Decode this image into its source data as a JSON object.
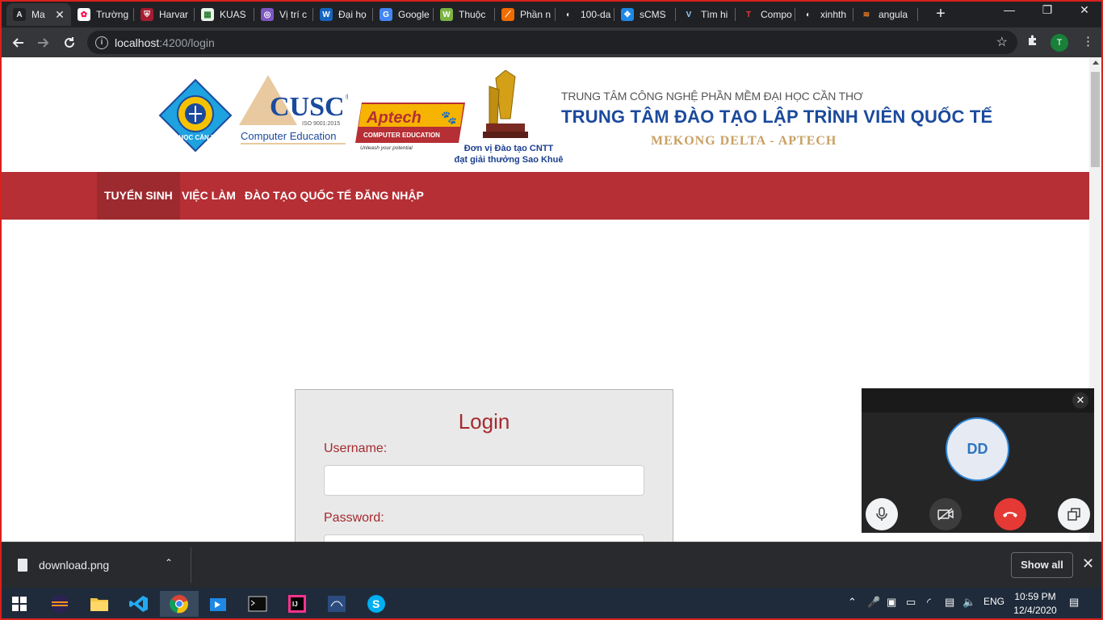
{
  "browser": {
    "tabs": [
      {
        "label": "Ma",
        "favicon": "A",
        "color": "#202124",
        "fg": "#e8eaed",
        "active": true
      },
      {
        "label": "Trường",
        "favicon": "✿",
        "color": "#ffffff",
        "fg": "#f04",
        "active": false
      },
      {
        "label": "Harvar",
        "favicon": "⛨",
        "color": "#a51c30",
        "fg": "#fff",
        "active": false
      },
      {
        "label": "KUAS",
        "favicon": "▦",
        "color": "#e8f5e9",
        "fg": "#2e7d32",
        "active": false
      },
      {
        "label": "Vị trí c",
        "favicon": "◎",
        "color": "#7e57c2",
        "fg": "#fff",
        "active": false
      },
      {
        "label": "Đại họ",
        "favicon": "W",
        "color": "#1565c0",
        "fg": "#fff",
        "active": false
      },
      {
        "label": "Google",
        "favicon": "G",
        "color": "#4285f4",
        "fg": "#fff",
        "active": false
      },
      {
        "label": "Thuộc",
        "favicon": "W",
        "color": "#7cb342",
        "fg": "#fff",
        "active": false
      },
      {
        "label": "Phần n",
        "favicon": "⟋",
        "color": "#ef6c00",
        "fg": "#fff",
        "active": false
      },
      {
        "label": "100-da",
        "favicon": "◐",
        "color": "#202124",
        "fg": "#e8eaed",
        "active": false
      },
      {
        "label": "sCMS",
        "favicon": "✥",
        "color": "#1e88e5",
        "fg": "#fff",
        "active": false
      },
      {
        "label": "Tìm hi",
        "favicon": "V",
        "color": "#202124",
        "fg": "#90caf9",
        "active": false
      },
      {
        "label": "Compo",
        "favicon": "T",
        "color": "#202124",
        "fg": "#e53935",
        "active": false
      },
      {
        "label": "xinhth",
        "favicon": "◐",
        "color": "#202124",
        "fg": "#e8eaed",
        "active": false
      },
      {
        "label": "angula",
        "favicon": "≋",
        "color": "#202124",
        "fg": "#f48024",
        "active": false
      }
    ],
    "new_tab": "+",
    "window_controls": {
      "minimize": "—",
      "maximize": "❐",
      "close": "✕"
    },
    "url_host": "localhost",
    "url_path": ":4200/login",
    "profile_initial": "T"
  },
  "header": {
    "ctu_logo_text": "ĐẠI HỌC CẦN THƠ",
    "cusc_logo": "CUSC",
    "cusc_iso": "ISO 9001:2015",
    "cusc_subtitle": "Computer Education",
    "aptech_logo": "Aptech",
    "aptech_sub": "COMPUTER EDUCATION",
    "aptech_tagline": "Unleash your potential",
    "award_line1": "Đơn vị Đào tạo CNTT",
    "award_line2": "đạt giải thưởng Sao Khuê",
    "org_small": "TRUNG TÂM CÔNG NGHỆ PHẦN MỀM ĐẠI HỌC CẦN THƠ",
    "org_big": "TRUNG TÂM ĐÀO TẠO LẬP TRÌNH VIÊN QUỐC TẾ",
    "org_sub": "MEKONG DELTA - APTECH"
  },
  "nav": [
    {
      "label": "TUYỂN SINH",
      "active": true
    },
    {
      "label": "VIỆC LÀM",
      "active": false
    },
    {
      "label": "ĐÀO TẠO QUỐC TẾ",
      "active": false
    },
    {
      "label": "ĐĂNG NHẬP",
      "active": false
    }
  ],
  "login": {
    "title": "Login",
    "username_label": "Username:",
    "username_value": "",
    "password_label": "Password:",
    "password_value": ""
  },
  "call": {
    "close": "✕",
    "initials": "DD",
    "colors": {
      "hangup": "#e53935",
      "avatar_ring": "#2f86d8"
    }
  },
  "download": {
    "file_name": "download.png",
    "show_all": "Show all",
    "close": "✕"
  },
  "taskbar": {
    "language": "ENG",
    "time": "10:59 PM",
    "date": "12/4/2020"
  },
  "colors": {
    "nav_red": "#b52f35",
    "title_red": "#a52a2f",
    "org_blue": "#1b4a9c",
    "org_gold": "#c9a063"
  }
}
